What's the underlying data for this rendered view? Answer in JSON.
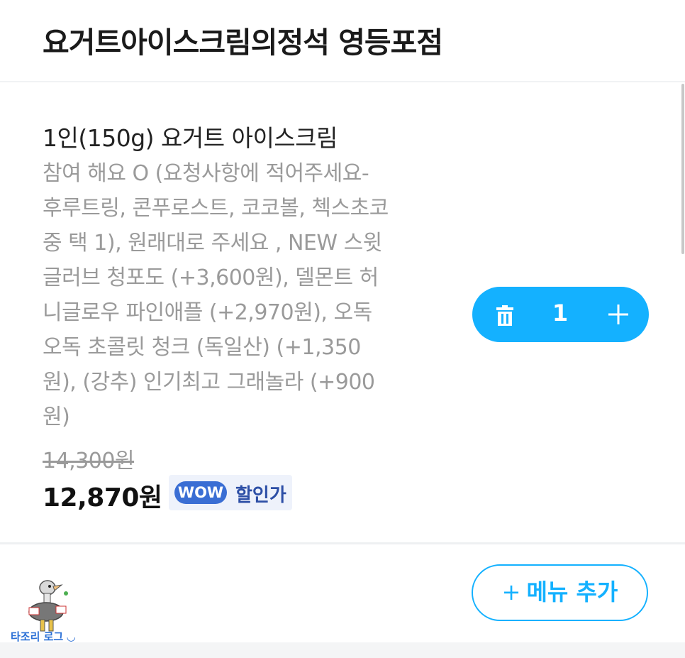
{
  "store": {
    "title": "요거트아이스크림의정석 영등포점"
  },
  "item": {
    "name": "1인(150g) 요거트 아이스크림",
    "option_lines": [
      "참여 해요 O (요청사항에 적어주세요-",
      "후루트링, 콘푸로스트, 코코볼, 첵스초코",
      "중 택 1), 원래대로 주세요 , NEW 스윗",
      "글러브 청포도 (+3,600원), 델몬트 허",
      "니글로우 파인애플  (+2,970원), 오독",
      "오독 초콜릿 청크 (독일산)  (+1,350",
      "원), (강추) 인기최고 그래놀라  (+900",
      "원)"
    ],
    "original_price": "14,300원",
    "final_price": "12,870원",
    "wow_badge": "WOW",
    "discount_label": "할인가",
    "quantity": "1"
  },
  "add_menu": {
    "plus": "+",
    "label": "메뉴 추가"
  },
  "watermark": {
    "text": "타조리 로그 ◡"
  },
  "icons": {
    "delete": "trash-icon",
    "increase": "plus-icon"
  },
  "colors": {
    "accent": "#14b1ff",
    "wow": "#3a6ed4",
    "muted": "#9a9a9a"
  }
}
